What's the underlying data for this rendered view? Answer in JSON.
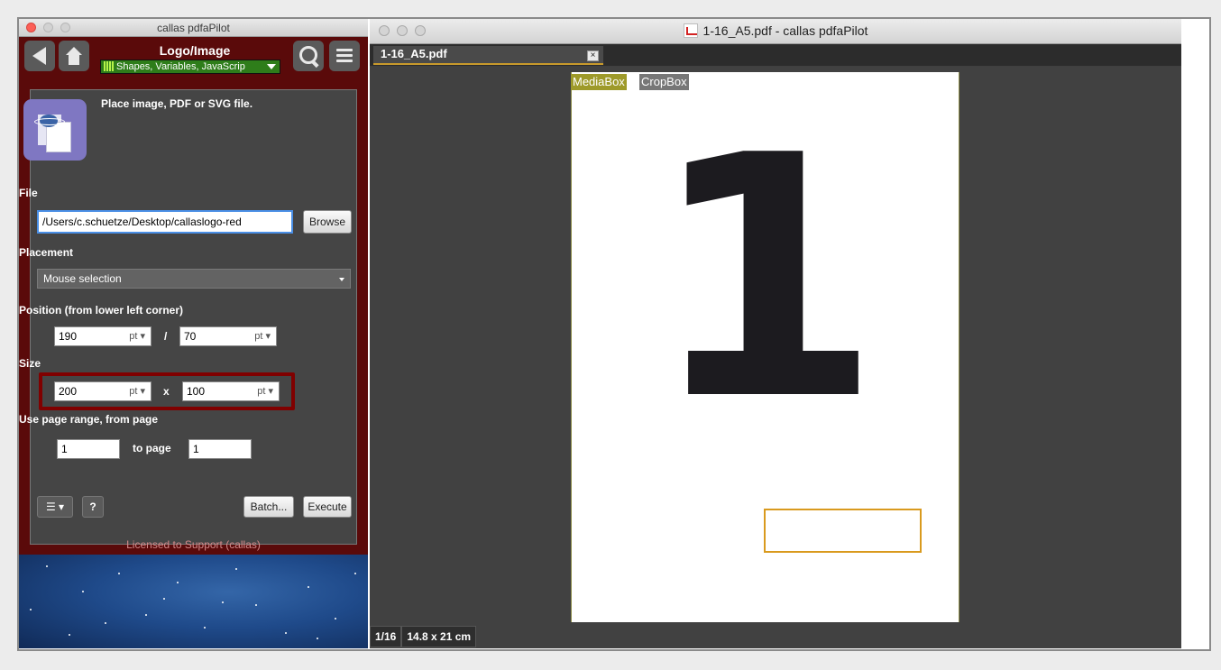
{
  "left_window": {
    "title": "callas pdfaPilot",
    "module_title": "Logo/Image",
    "category": "Shapes, Variables, JavaScrip",
    "description": "Place image, PDF or SVG file.",
    "file": {
      "label": "File",
      "value": "/Users/c.schuetze/Desktop/callaslogo-red",
      "browse": "Browse"
    },
    "placement": {
      "label": "Placement",
      "value": "Mouse selection"
    },
    "position": {
      "label": "Position (from lower left corner)",
      "x": "190",
      "x_unit": "pt",
      "separator": "/",
      "y": "70",
      "y_unit": "pt"
    },
    "size": {
      "label": "Size",
      "w": "200",
      "w_unit": "pt",
      "separator": "x",
      "h": "100",
      "h_unit": "pt"
    },
    "page_range": {
      "label": "Use page range, from page",
      "from": "1",
      "to_label": "to page",
      "to": "1"
    },
    "buttons": {
      "menu": "☰",
      "help": "?",
      "batch": "Batch...",
      "execute": "Execute"
    },
    "licensed": "Licensed to Support (callas)"
  },
  "right_window": {
    "title": "1-16_A5.pdf - callas pdfaPilot",
    "tab": "1-16_A5.pdf",
    "tab_close": "×",
    "mediabox": "MediaBox",
    "cropbox": "CropBox",
    "page_content": "1",
    "status_page": "1/16",
    "status_size": "14.8 x 21 cm"
  },
  "colors": {
    "panel_bg": "#5a0a0a",
    "category_green": "#2e7d1a",
    "highlight": "#800000",
    "selection": "#d99a1e",
    "mediabox": "#9e9a2a"
  }
}
